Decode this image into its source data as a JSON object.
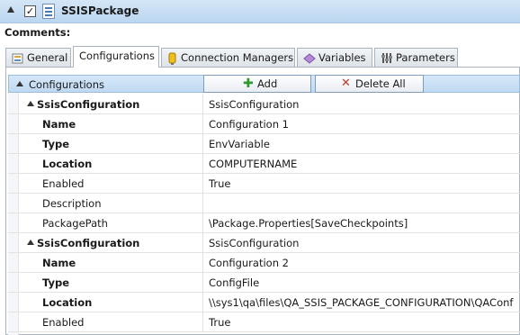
{
  "package": {
    "title": "SSISPackage",
    "checked": "✓"
  },
  "comments_label": "Comments:",
  "tabs": [
    {
      "label": "General",
      "icon": "general-icon"
    },
    {
      "label": "Configurations",
      "icon": ""
    },
    {
      "label": "Connection Managers",
      "icon": "connection-icon"
    },
    {
      "label": "Variables",
      "icon": "variables-icon"
    },
    {
      "label": "Parameters",
      "icon": "parameters-icon"
    }
  ],
  "grid": {
    "header": "Configurations",
    "add_label": "Add",
    "delete_all_label": "Delete All"
  },
  "rows": [
    {
      "name": "SsisConfiguration",
      "value": "SsisConfiguration",
      "kind": "group"
    },
    {
      "name": "Name",
      "value": "Configuration 1",
      "kind": "bold"
    },
    {
      "name": "Type",
      "value": "EnvVariable",
      "kind": "bold"
    },
    {
      "name": "Location",
      "value": "COMPUTERNAME",
      "kind": "bold"
    },
    {
      "name": "Enabled",
      "value": "True",
      "kind": "plain"
    },
    {
      "name": "Description",
      "value": "",
      "kind": "plain"
    },
    {
      "name": "PackagePath",
      "value": "\\Package.Properties[SaveCheckpoints]",
      "kind": "plain"
    },
    {
      "name": "SsisConfiguration",
      "value": "SsisConfiguration",
      "kind": "group"
    },
    {
      "name": "Name",
      "value": "Configuration 2",
      "kind": "bold"
    },
    {
      "name": "Type",
      "value": "ConfigFile",
      "kind": "bold"
    },
    {
      "name": "Location",
      "value": "\\\\sys1\\qa\\files\\QA_SSIS_PACKAGE_CONFIGURATION\\QAConf",
      "kind": "bold"
    },
    {
      "name": "Enabled",
      "value": "True",
      "kind": "plain"
    }
  ],
  "colors": {
    "header_bg": "#bcd6f0",
    "add_icon": "#2e9a2e",
    "delete_icon": "#c0392b"
  }
}
